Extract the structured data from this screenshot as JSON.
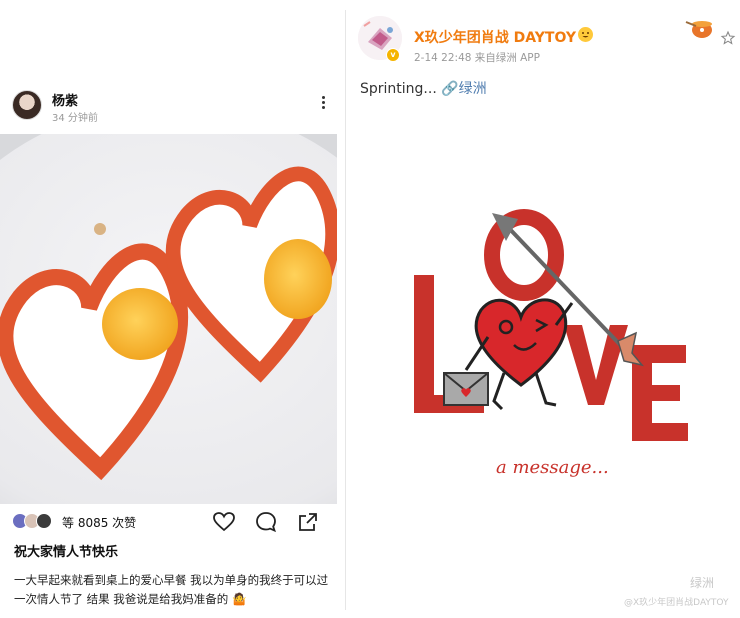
{
  "left_post": {
    "username": "杨紫",
    "time": "34 分钟前",
    "likes": "等 8085 次赞",
    "caption_title": "祝大家情人节快乐",
    "caption_body": "一大早起来就看到桌上的爱心早餐 我以为单身的我终于可以过一次情人节了 结果 我爸说是给我妈准备的",
    "caption_emoji": "🤷"
  },
  "right_post": {
    "account_name": "X玖少年团肖战 DAYTOY",
    "meta": "2-14 22:48  来自绿洲 APP",
    "text_prefix": "Sprinting... ",
    "link_text": "🔗绿洲",
    "verified_badge": "v",
    "artwork": {
      "word": "LOVE",
      "subtitle": "a message..."
    },
    "watermark_brand": "绿洲",
    "watermark_user": "@X玖少年团肖战DAYTOY"
  },
  "icons": {
    "more": "more-dots-icon",
    "like": "heart-icon",
    "comment": "comment-icon",
    "share": "share-icon",
    "star": "star-icon",
    "emoji": "smile-emoji-icon"
  },
  "colors": {
    "weibo_orange": "#f07b0f",
    "link_blue": "#507daf",
    "love_red": "#c8322b"
  }
}
